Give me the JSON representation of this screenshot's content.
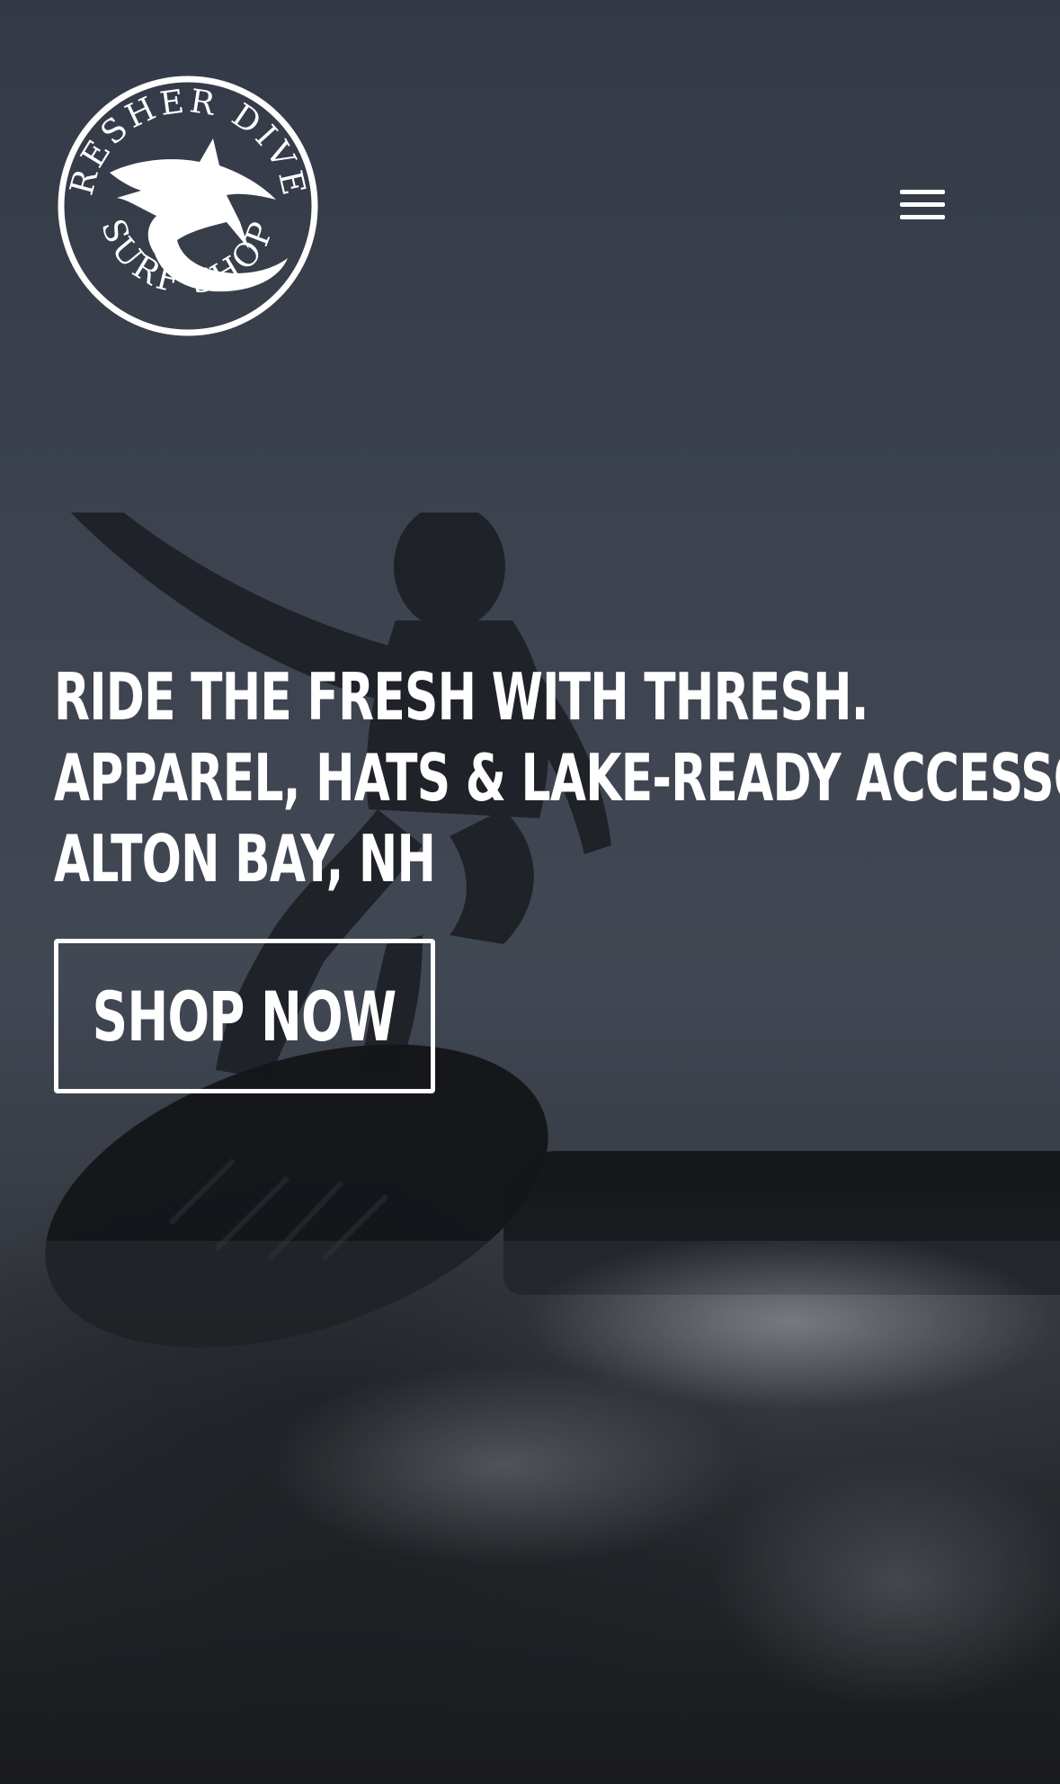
{
  "header": {
    "logo": {
      "top_text": "THRESHER DIVERS",
      "bottom_text": "SURF SHOP",
      "icon": "thresher-shark-icon"
    },
    "menu_icon": "hamburger-menu-icon"
  },
  "hero": {
    "headline_lines": [
      "RIDE THE FRESH WITH THRESH.",
      "APPAREL, HATS & LAKE-READY ACCESSORIES.",
      "ALTON BAY, NH"
    ],
    "cta_label": "SHOP NOW"
  },
  "colors": {
    "text": "#ffffff",
    "background_overlay": "#2a2f37"
  }
}
